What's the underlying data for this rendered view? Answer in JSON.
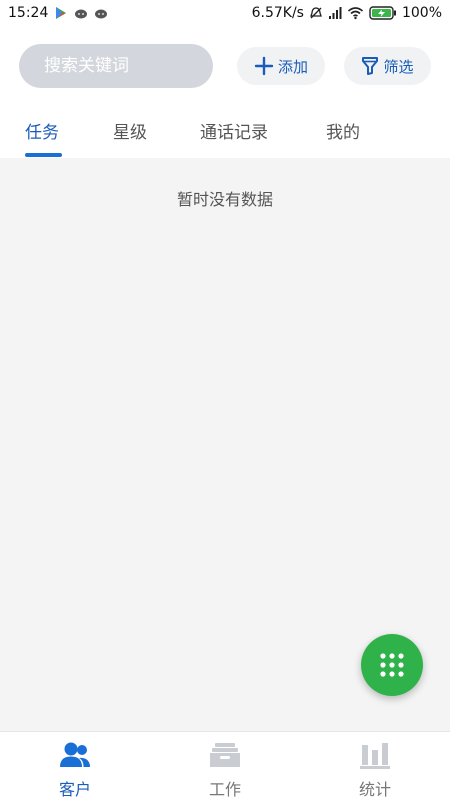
{
  "status_bar": {
    "time": "15:24",
    "net_speed": "6.57K/s",
    "battery": "100%"
  },
  "search": {
    "placeholder": "搜索关键词",
    "value": ""
  },
  "actions": {
    "add_label": "添加",
    "filter_label": "筛选"
  },
  "tabs": [
    {
      "label": "任务",
      "active": true
    },
    {
      "label": "星级",
      "active": false
    },
    {
      "label": "通话记录",
      "active": false
    },
    {
      "label": "我的",
      "active": false
    }
  ],
  "empty_message": "暂时没有数据",
  "bottom_nav": [
    {
      "label": "客户",
      "icon": "people-icon",
      "active": true
    },
    {
      "label": "工作",
      "icon": "inbox-icon",
      "active": false
    },
    {
      "label": "统计",
      "icon": "bar-chart-icon",
      "active": false
    }
  ],
  "colors": {
    "accent": "#1a5db8",
    "fab": "#2fb24a",
    "content_bg": "#f4f4f4",
    "search_bg": "#d3d6dc"
  }
}
